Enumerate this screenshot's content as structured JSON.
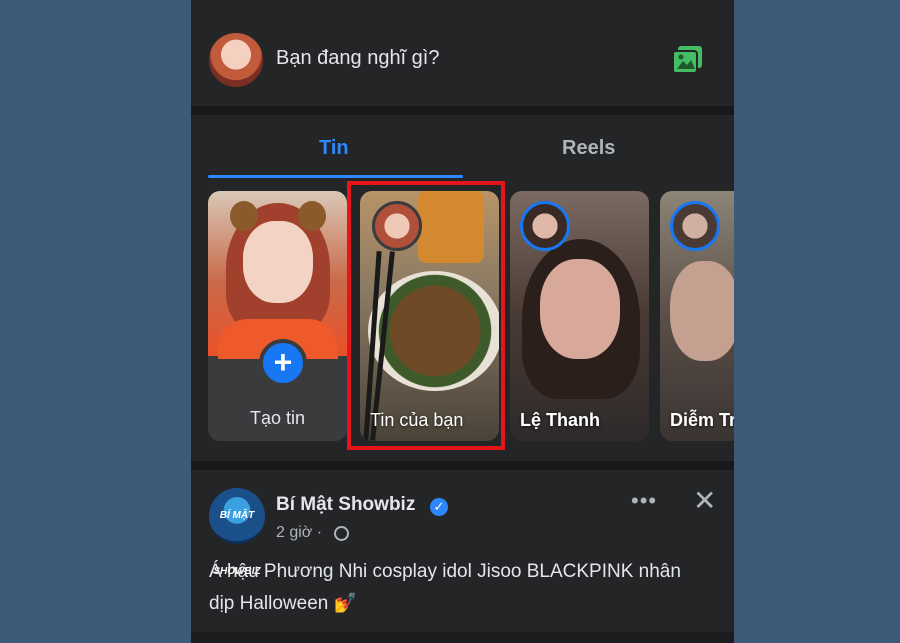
{
  "composer": {
    "placeholder": "Bạn đang nghĩ gì?"
  },
  "tabs": [
    {
      "label": "Tin",
      "active": true
    },
    {
      "label": "Reels",
      "active": false
    }
  ],
  "stories": [
    {
      "label": "Tạo tin"
    },
    {
      "label": "Tin của bạn"
    },
    {
      "label": "Lệ Thanh"
    },
    {
      "label": "Diễm Tri"
    }
  ],
  "post": {
    "page_name": "Bí Mật Showbiz",
    "time": "2 giờ ·",
    "text": "Á hậu Phương Nhi cosplay idol Jisoo BLACKPINK nhân dịp Halloween 💅",
    "avatar_text": "BÍ MẬT SHOWBIZ"
  },
  "colors": {
    "accent": "#2d88ff",
    "highlight": "#e5161b",
    "background": "#242526"
  }
}
